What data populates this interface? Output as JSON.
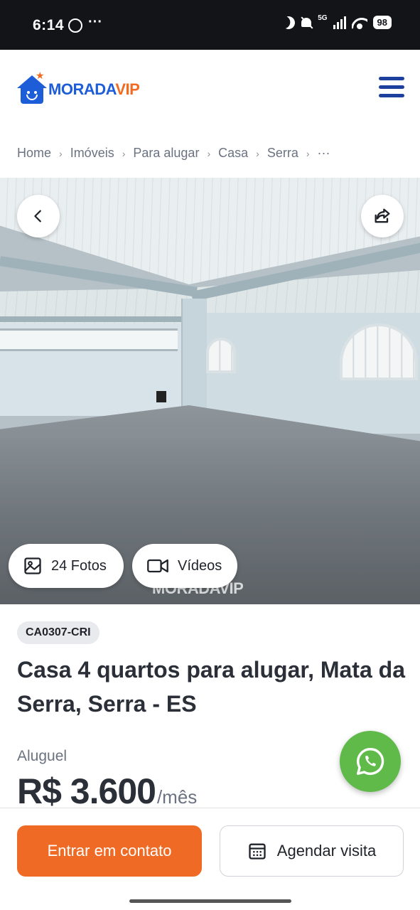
{
  "status_bar": {
    "time": "6:14",
    "dots": "···",
    "network": "5G",
    "battery": "98"
  },
  "header": {
    "logo_part1": "MORADA",
    "logo_part2": "VIP"
  },
  "breadcrumb": {
    "items": [
      "Home",
      "Imóveis",
      "Para alugar",
      "Casa",
      "Serra"
    ],
    "ellipsis": "···"
  },
  "gallery": {
    "photos_label": "24 Fotos",
    "videos_label": "Vídeos",
    "watermark": "MORADAVIP"
  },
  "listing": {
    "code": "CA0307-CRI",
    "title": "Casa 4 quartos para alugar, Mata da Serra, Serra - ES",
    "price_label": "Aluguel",
    "price_value": "R$ 3.600",
    "price_unit": "/mês"
  },
  "actions": {
    "contact_label": "Entrar em contato",
    "visit_label": "Agendar visita"
  },
  "colors": {
    "brand_blue": "#1d5dd8",
    "brand_orange": "#f26b21",
    "primary_button": "#ef6a25",
    "whatsapp_green": "#5fba4a",
    "status_bar_bg": "#121418"
  },
  "icons": {
    "menu": "hamburger-icon",
    "back": "chevron-left-icon",
    "share": "share-icon",
    "photos": "image-icon",
    "videos": "video-camera-icon",
    "whatsapp": "whatsapp-icon",
    "calendar": "calendar-icon"
  }
}
